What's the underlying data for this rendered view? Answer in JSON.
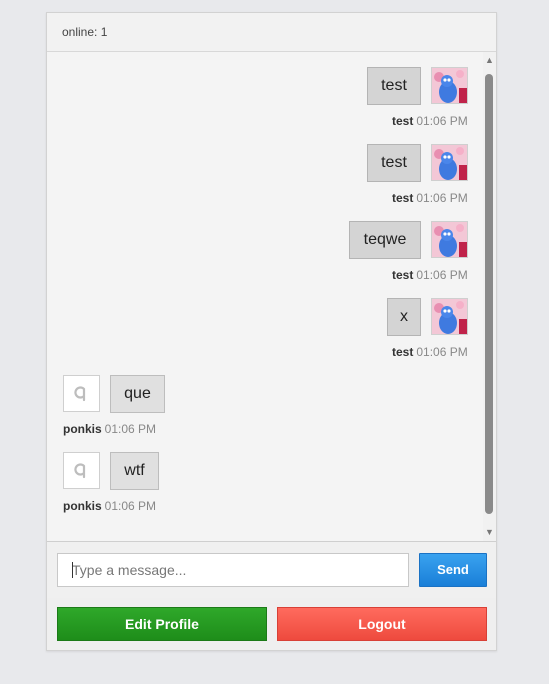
{
  "header": {
    "online_text": "online: 1"
  },
  "messages": [
    {
      "user": "test",
      "text": "test",
      "time": "01:06 PM",
      "own": true
    },
    {
      "user": "test",
      "text": "test",
      "time": "01:06 PM",
      "own": true
    },
    {
      "user": "test",
      "text": "teqwe",
      "time": "01:06 PM",
      "own": true
    },
    {
      "user": "test",
      "text": "x",
      "time": "01:06 PM",
      "own": true
    },
    {
      "user": "ponkis",
      "text": "que",
      "time": "01:06 PM",
      "own": false
    },
    {
      "user": "ponkis",
      "text": "wtf",
      "time": "01:06 PM",
      "own": false
    }
  ],
  "composer": {
    "placeholder": "Type a message...",
    "send_label": "Send"
  },
  "footer": {
    "edit_label": "Edit Profile",
    "logout_label": "Logout"
  }
}
